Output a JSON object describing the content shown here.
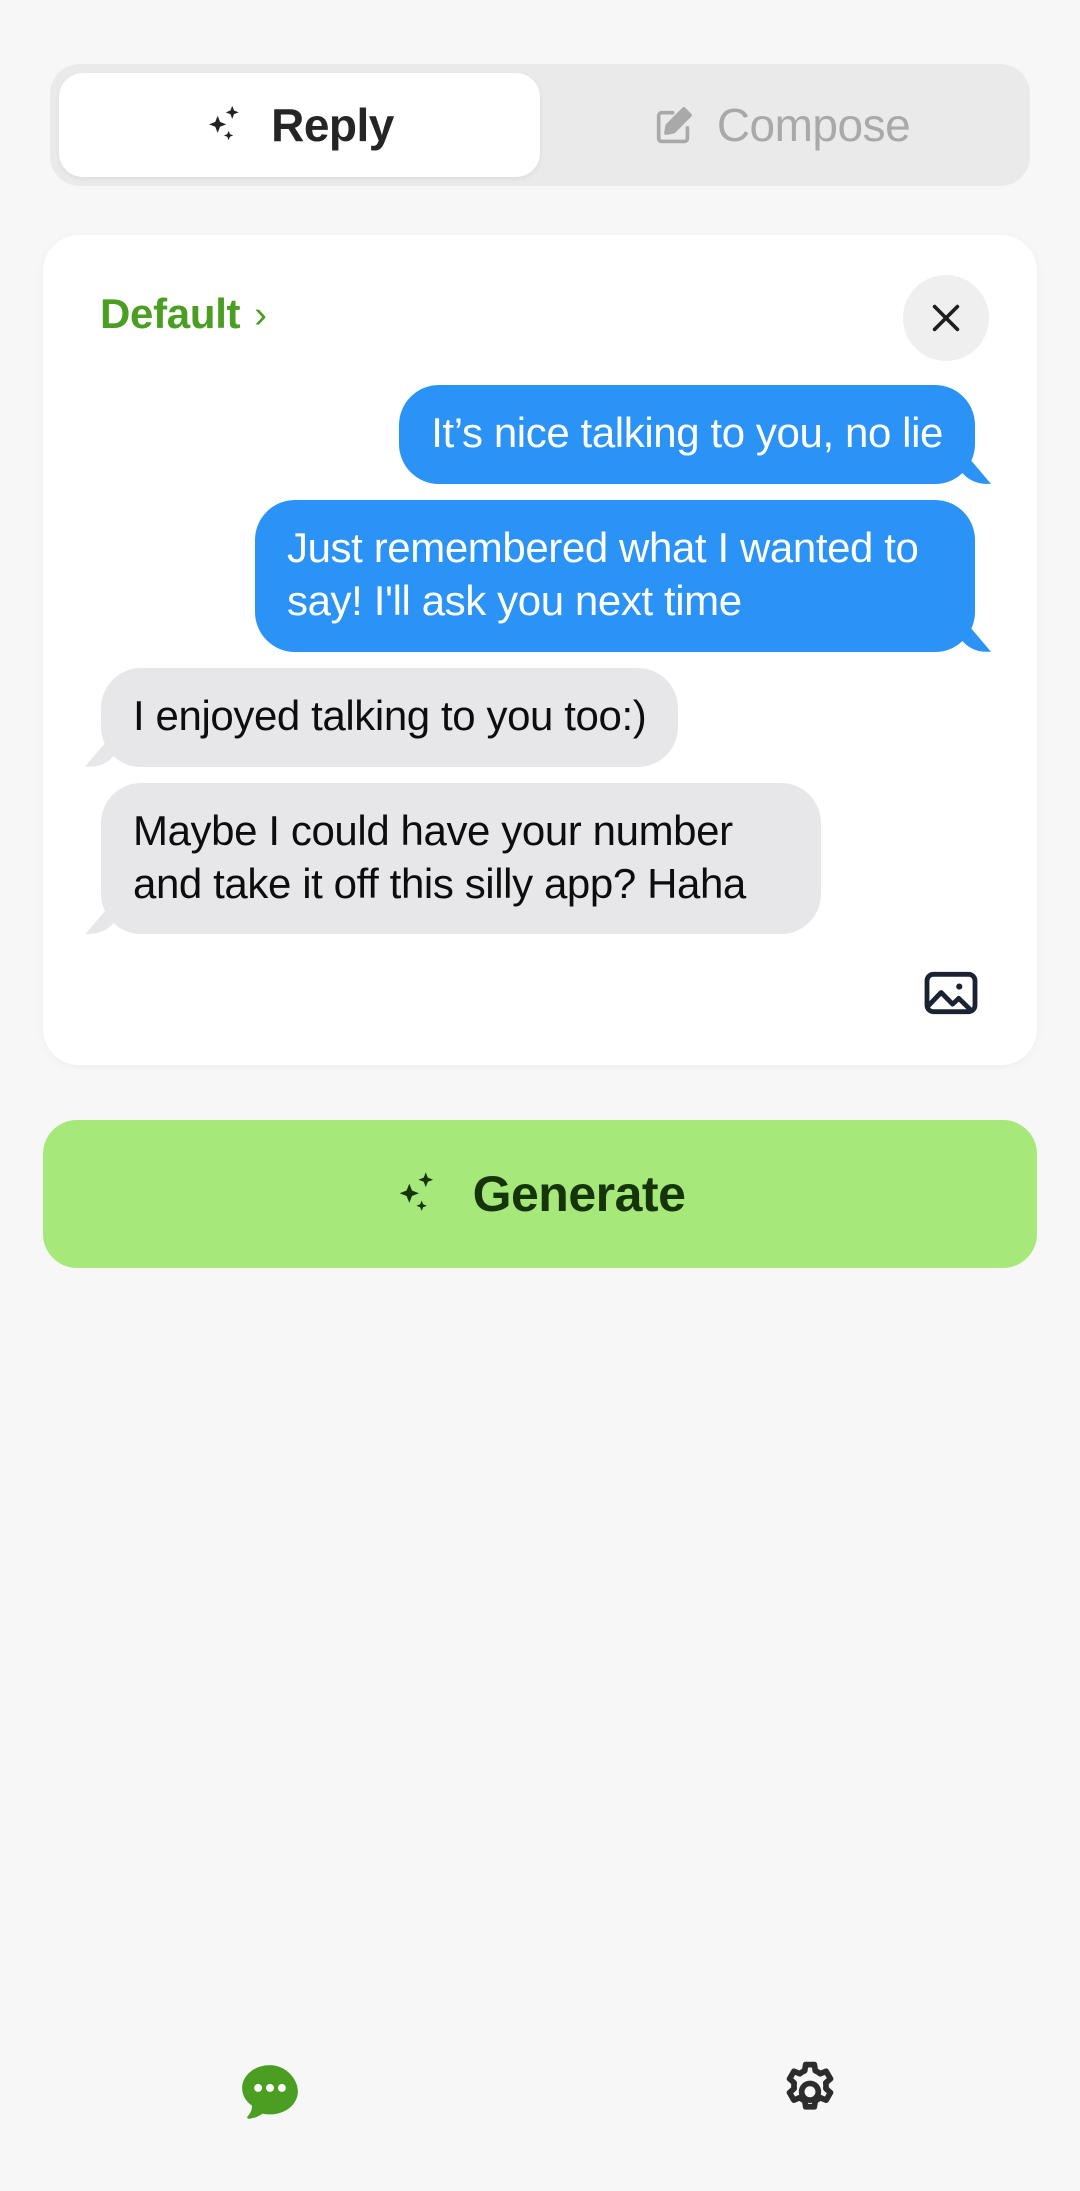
{
  "tabs": [
    {
      "label": "Reply",
      "icon": "sparkles-icon",
      "active": true
    },
    {
      "label": "Compose",
      "icon": "pencil-square-icon",
      "active": false
    }
  ],
  "card": {
    "preset_label": "Default",
    "preset_chevron": "›",
    "close_icon": "close-icon",
    "attach_image_icon": "image-icon",
    "messages": [
      {
        "side": "outgoing",
        "text": "It’s nice talking to you, no lie"
      },
      {
        "side": "outgoing",
        "text": "Just remembered what I wanted to say! I'll ask you next time"
      },
      {
        "side": "incoming",
        "text": "I enjoyed talking to you too:)"
      },
      {
        "side": "incoming",
        "text": "Maybe I could have your number and take it off this silly app? Haha"
      }
    ]
  },
  "generate": {
    "label": "Generate",
    "icon": "sparkles-icon"
  },
  "bottom_nav": [
    {
      "name": "chat-tab",
      "icon": "chat-bubble-dots-icon",
      "active": true
    },
    {
      "name": "settings-tab",
      "icon": "gear-icon",
      "active": false
    }
  ],
  "colors": {
    "page_background": "#f7f7f7",
    "tab_track": "#eaeaea",
    "accent_green": "#4a9e21",
    "generate_green": "#a6e879",
    "generate_text": "#16340a",
    "outgoing_bubble": "#2a93f5",
    "incoming_bubble": "#e7e7e9",
    "card_white": "#ffffff",
    "inactive_gray": "#a9a9a9"
  }
}
